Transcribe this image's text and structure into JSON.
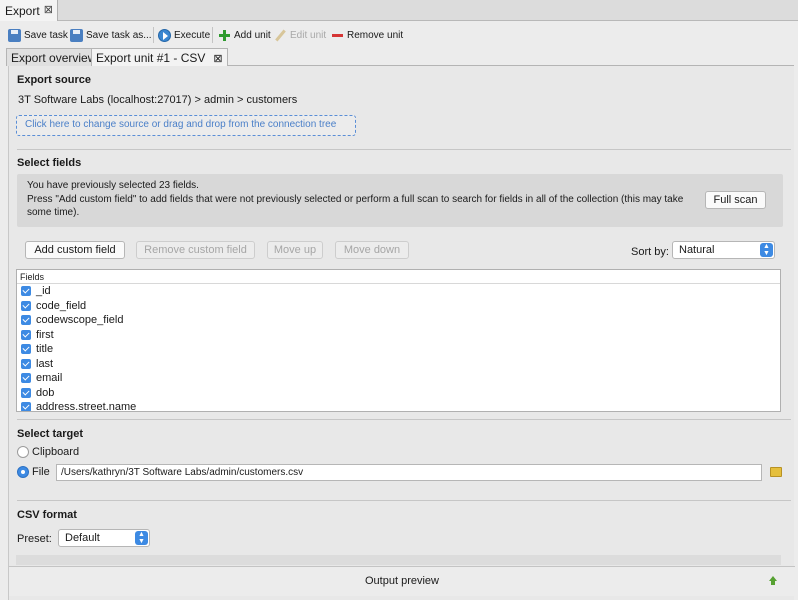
{
  "view_tab": {
    "label": "Export"
  },
  "toolbar": {
    "save_task": "Save task",
    "save_task_as": "Save task as...",
    "execute": "Execute",
    "add_unit": "Add unit",
    "edit_unit": "Edit unit",
    "remove_unit": "Remove unit"
  },
  "tabs": [
    {
      "label": "Export overview"
    },
    {
      "label": "Export unit #1 - CSV"
    }
  ],
  "export_source": {
    "heading": "Export source",
    "path": "3T Software Labs (localhost:27017) > admin > customers",
    "dropzone": "Click here to change source or drag and drop from the connection tree"
  },
  "select_fields": {
    "heading": "Select fields",
    "info_line1": "You have previously selected 23 fields.",
    "info_line2": "Press \"Add custom field\" to add fields that were not previously selected or perform a full scan to search for fields in all of the collection (this may take some time).",
    "full_scan": "Full scan",
    "add_custom_field": "Add custom field",
    "remove_custom_field": "Remove custom field",
    "move_up": "Move up",
    "move_down": "Move down",
    "sort_by_label": "Sort by:",
    "sort_by_value": "Natural",
    "fields_header": "Fields",
    "fields": [
      "_id",
      "code_field",
      "codewscope_field",
      "first",
      "title",
      "last",
      "email",
      "dob",
      "address.street.name"
    ]
  },
  "select_target": {
    "heading": "Select target",
    "clipboard": "Clipboard",
    "file": "File",
    "file_path": "/Users/kathryn/3T Software Labs/admin/customers.csv"
  },
  "csv_format": {
    "heading": "CSV format",
    "preset_label": "Preset:",
    "preset_value": "Default"
  },
  "output_preview": "Output preview",
  "colors": {
    "accent": "#3d8ae3",
    "link": "#4a7fc8",
    "remove": "#d53535",
    "add": "#2e9a2e"
  }
}
